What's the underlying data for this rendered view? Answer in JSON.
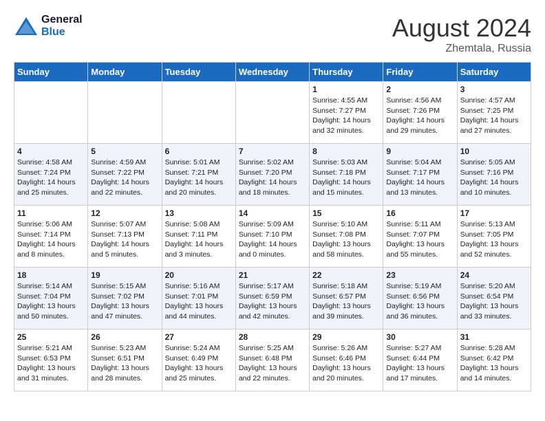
{
  "logo": {
    "line1": "General",
    "line2": "Blue"
  },
  "title": "August 2024",
  "location": "Zhemtala, Russia",
  "days_of_week": [
    "Sunday",
    "Monday",
    "Tuesday",
    "Wednesday",
    "Thursday",
    "Friday",
    "Saturday"
  ],
  "weeks": [
    [
      {
        "day": "",
        "info": ""
      },
      {
        "day": "",
        "info": ""
      },
      {
        "day": "",
        "info": ""
      },
      {
        "day": "",
        "info": ""
      },
      {
        "day": "1",
        "info": "Sunrise: 4:55 AM\nSunset: 7:27 PM\nDaylight: 14 hours\nand 32 minutes."
      },
      {
        "day": "2",
        "info": "Sunrise: 4:56 AM\nSunset: 7:26 PM\nDaylight: 14 hours\nand 29 minutes."
      },
      {
        "day": "3",
        "info": "Sunrise: 4:57 AM\nSunset: 7:25 PM\nDaylight: 14 hours\nand 27 minutes."
      }
    ],
    [
      {
        "day": "4",
        "info": "Sunrise: 4:58 AM\nSunset: 7:24 PM\nDaylight: 14 hours\nand 25 minutes."
      },
      {
        "day": "5",
        "info": "Sunrise: 4:59 AM\nSunset: 7:22 PM\nDaylight: 14 hours\nand 22 minutes."
      },
      {
        "day": "6",
        "info": "Sunrise: 5:01 AM\nSunset: 7:21 PM\nDaylight: 14 hours\nand 20 minutes."
      },
      {
        "day": "7",
        "info": "Sunrise: 5:02 AM\nSunset: 7:20 PM\nDaylight: 14 hours\nand 18 minutes."
      },
      {
        "day": "8",
        "info": "Sunrise: 5:03 AM\nSunset: 7:18 PM\nDaylight: 14 hours\nand 15 minutes."
      },
      {
        "day": "9",
        "info": "Sunrise: 5:04 AM\nSunset: 7:17 PM\nDaylight: 14 hours\nand 13 minutes."
      },
      {
        "day": "10",
        "info": "Sunrise: 5:05 AM\nSunset: 7:16 PM\nDaylight: 14 hours\nand 10 minutes."
      }
    ],
    [
      {
        "day": "11",
        "info": "Sunrise: 5:06 AM\nSunset: 7:14 PM\nDaylight: 14 hours\nand 8 minutes."
      },
      {
        "day": "12",
        "info": "Sunrise: 5:07 AM\nSunset: 7:13 PM\nDaylight: 14 hours\nand 5 minutes."
      },
      {
        "day": "13",
        "info": "Sunrise: 5:08 AM\nSunset: 7:11 PM\nDaylight: 14 hours\nand 3 minutes."
      },
      {
        "day": "14",
        "info": "Sunrise: 5:09 AM\nSunset: 7:10 PM\nDaylight: 14 hours\nand 0 minutes."
      },
      {
        "day": "15",
        "info": "Sunrise: 5:10 AM\nSunset: 7:08 PM\nDaylight: 13 hours\nand 58 minutes."
      },
      {
        "day": "16",
        "info": "Sunrise: 5:11 AM\nSunset: 7:07 PM\nDaylight: 13 hours\nand 55 minutes."
      },
      {
        "day": "17",
        "info": "Sunrise: 5:13 AM\nSunset: 7:05 PM\nDaylight: 13 hours\nand 52 minutes."
      }
    ],
    [
      {
        "day": "18",
        "info": "Sunrise: 5:14 AM\nSunset: 7:04 PM\nDaylight: 13 hours\nand 50 minutes."
      },
      {
        "day": "19",
        "info": "Sunrise: 5:15 AM\nSunset: 7:02 PM\nDaylight: 13 hours\nand 47 minutes."
      },
      {
        "day": "20",
        "info": "Sunrise: 5:16 AM\nSunset: 7:01 PM\nDaylight: 13 hours\nand 44 minutes."
      },
      {
        "day": "21",
        "info": "Sunrise: 5:17 AM\nSunset: 6:59 PM\nDaylight: 13 hours\nand 42 minutes."
      },
      {
        "day": "22",
        "info": "Sunrise: 5:18 AM\nSunset: 6:57 PM\nDaylight: 13 hours\nand 39 minutes."
      },
      {
        "day": "23",
        "info": "Sunrise: 5:19 AM\nSunset: 6:56 PM\nDaylight: 13 hours\nand 36 minutes."
      },
      {
        "day": "24",
        "info": "Sunrise: 5:20 AM\nSunset: 6:54 PM\nDaylight: 13 hours\nand 33 minutes."
      }
    ],
    [
      {
        "day": "25",
        "info": "Sunrise: 5:21 AM\nSunset: 6:53 PM\nDaylight: 13 hours\nand 31 minutes."
      },
      {
        "day": "26",
        "info": "Sunrise: 5:23 AM\nSunset: 6:51 PM\nDaylight: 13 hours\nand 28 minutes."
      },
      {
        "day": "27",
        "info": "Sunrise: 5:24 AM\nSunset: 6:49 PM\nDaylight: 13 hours\nand 25 minutes."
      },
      {
        "day": "28",
        "info": "Sunrise: 5:25 AM\nSunset: 6:48 PM\nDaylight: 13 hours\nand 22 minutes."
      },
      {
        "day": "29",
        "info": "Sunrise: 5:26 AM\nSunset: 6:46 PM\nDaylight: 13 hours\nand 20 minutes."
      },
      {
        "day": "30",
        "info": "Sunrise: 5:27 AM\nSunset: 6:44 PM\nDaylight: 13 hours\nand 17 minutes."
      },
      {
        "day": "31",
        "info": "Sunrise: 5:28 AM\nSunset: 6:42 PM\nDaylight: 13 hours\nand 14 minutes."
      }
    ]
  ]
}
